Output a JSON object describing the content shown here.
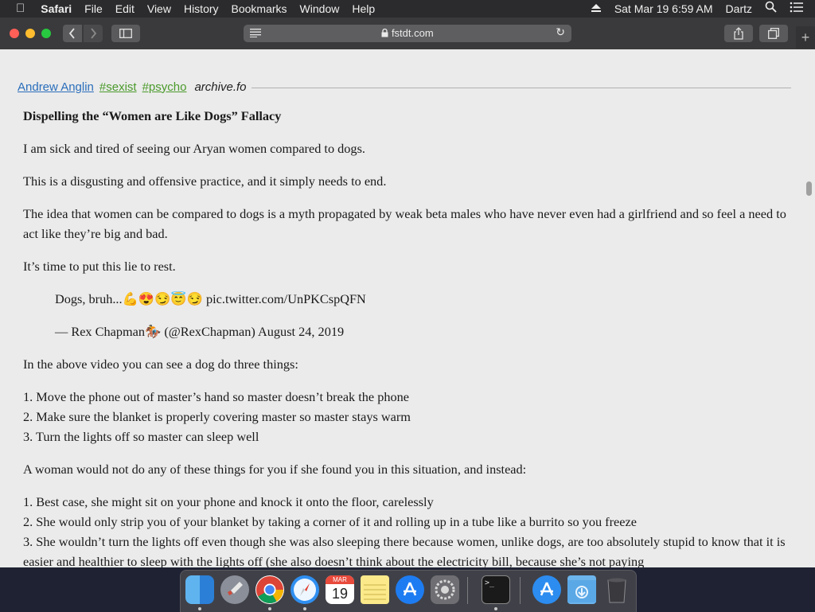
{
  "menubar": {
    "app_name": "Safari",
    "menus": [
      "File",
      "Edit",
      "View",
      "History",
      "Bookmarks",
      "Window",
      "Help"
    ],
    "datetime": "Sat Mar 19  6:59 AM",
    "user": "Dartz"
  },
  "browser": {
    "url": "fstdt.com"
  },
  "tags": {
    "author": "Andrew Anglin",
    "tag1": "#sexist",
    "tag2": "#psycho",
    "archive": "archive.fo"
  },
  "article": {
    "title": "Dispelling the “Women are Like Dogs” Fallacy",
    "p1": "I am sick and tired of seeing our Aryan women compared to dogs.",
    "p2": "This is a disgusting and offensive practice, and it simply needs to end.",
    "p3": "The idea that women can be compared to dogs is a myth propagated by weak beta males who have never even had a girlfriend and so feel a need to act like they’re big and bad.",
    "p4": "It’s time to put this lie to rest.",
    "quote_line1": "Dogs, bruh...💪😍😏😇😏 pic.twitter.com/UnPKCspQFN",
    "quote_line2": "— Rex Chapman🏇 (@RexChapman) August 24, 2019",
    "p5": "In the above video you can see a dog do three things:",
    "list1": [
      "1. Move the phone out of master’s hand so master doesn’t break the phone",
      "2. Make sure the blanket is properly covering master so master stays warm",
      "3. Turn the lights off so master can sleep well"
    ],
    "p6": "A woman would not do any of these things for you if she found you in this situation, and instead:",
    "list2": [
      "1. Best case, she might sit on your phone and knock it onto the floor, carelessly",
      "2. She would only strip you of your blanket by taking a corner of it and rolling up in a tube like a burrito so you freeze",
      "3. She wouldn’t turn the lights off even though she was also sleeping there because women, unlike dogs, are too absolutely stupid to know that it is easier and healthier to sleep with the lights off (she also doesn’t think about the electricity bill, because she’s not paying"
    ]
  },
  "dock": {
    "calendar_month": "MAR",
    "calendar_day": "19",
    "terminal_prompt": ">_"
  },
  "colors": {
    "link_blue": "#2a6ebb",
    "tag_green": "#4a9a2a",
    "page_bg": "#ebebeb"
  }
}
